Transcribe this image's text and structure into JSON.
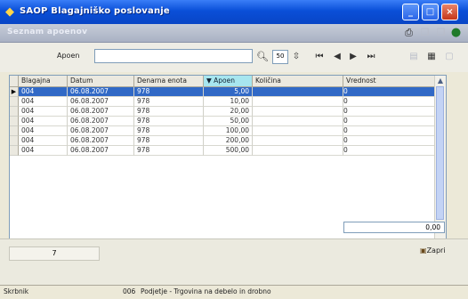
{
  "window": {
    "title": "SAOP Blagajniško poslovanje",
    "buttons": [
      "_",
      "□",
      "×"
    ]
  },
  "subheader": {
    "label": "Seznam apoenov"
  },
  "filter": {
    "label": "Apoen",
    "value": "",
    "page_size": "50"
  },
  "grid": {
    "columns": [
      "Blagajna",
      "Datum",
      "Denarna enota",
      "Apoen",
      "Količina",
      "Vrednost"
    ],
    "sorted_column": "Apoen",
    "rows": [
      [
        "004",
        "06.08.2007",
        "978",
        "5,00",
        "",
        "0"
      ],
      [
        "004",
        "06.08.2007",
        "978",
        "10,00",
        "",
        "0"
      ],
      [
        "004",
        "06.08.2007",
        "978",
        "20,00",
        "",
        "0"
      ],
      [
        "004",
        "06.08.2007",
        "978",
        "50,00",
        "",
        "0"
      ],
      [
        "004",
        "06.08.2007",
        "978",
        "100,00",
        "",
        "0"
      ],
      [
        "004",
        "06.08.2007",
        "978",
        "200,00",
        "",
        "0"
      ],
      [
        "004",
        "06.08.2007",
        "978",
        "500,00",
        "",
        "0"
      ]
    ],
    "selected_row": 0,
    "total": "0,00"
  },
  "footer": {
    "record_count": "7",
    "close_label": "Zapri"
  },
  "status": {
    "left": "Skrbnik",
    "code": "006",
    "company": "Podjetje - Trgovina na debelo in drobno"
  }
}
